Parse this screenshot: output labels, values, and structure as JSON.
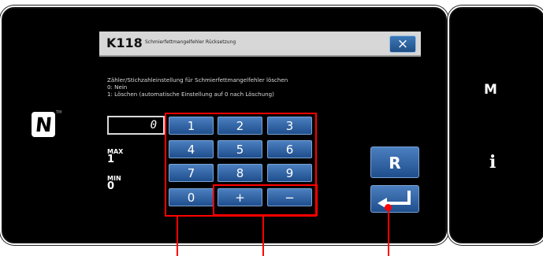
{
  "nfc": {
    "mark": "N",
    "tm": "TM"
  },
  "dialog": {
    "code": "K118",
    "title": "Schmierfettmangelfehler Rücksetzung",
    "description": [
      "Zähler/Stichzahleinstellung für Schmierfettmangelfehler löschen",
      "0: Nein",
      "1: Löschen (automatische Einstellung auf 0 nach Löschung)"
    ],
    "close_symbol": "×"
  },
  "value_display": "0",
  "range": {
    "max_label": "MAX",
    "max_value": "1",
    "min_label": "MIN",
    "min_value": "0"
  },
  "keypad": {
    "keys": [
      "1",
      "2",
      "3",
      "4",
      "5",
      "6",
      "7",
      "8",
      "9"
    ],
    "zero": "0",
    "plus": "+",
    "minus": "−"
  },
  "buttons": {
    "reset": "R"
  },
  "side": {
    "m": "M",
    "info": "i"
  },
  "colors": {
    "panel": "#000000",
    "key": "#2f65a6",
    "highlight": "#ff0000",
    "titlebar": "#d7d7d7"
  },
  "icons": {
    "close": "close-icon",
    "enter": "enter-arrow-icon",
    "nfc": "nfc-icon"
  }
}
